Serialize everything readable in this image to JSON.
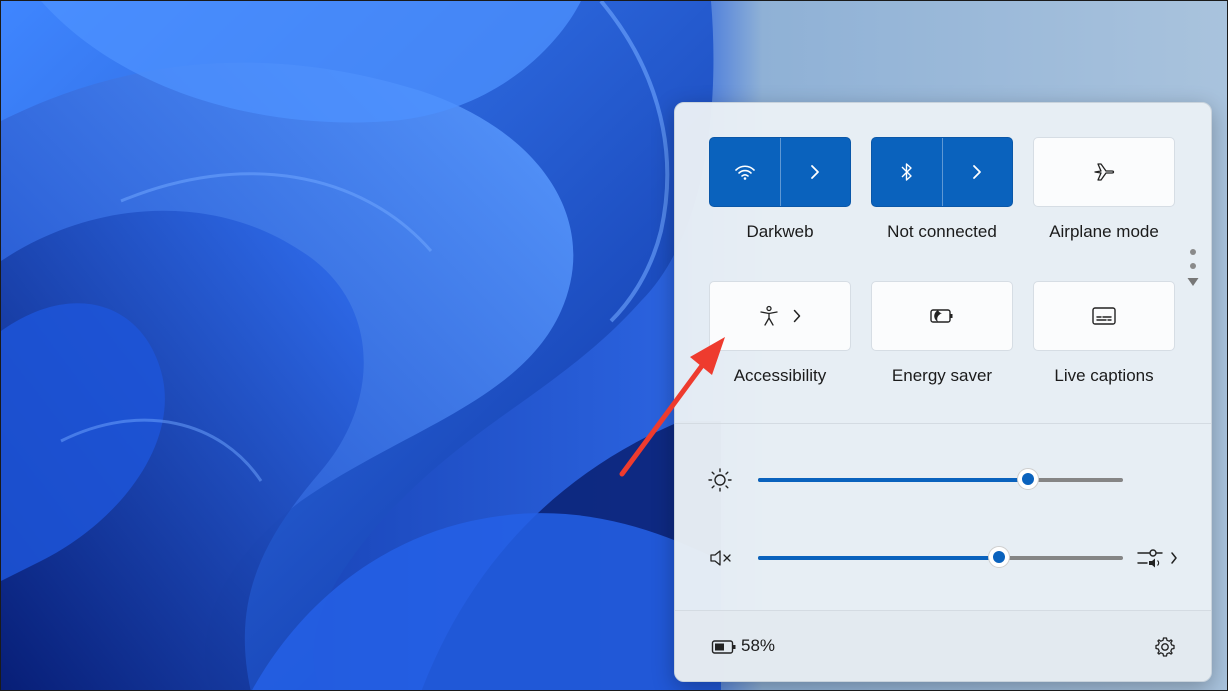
{
  "quick_settings": {
    "tiles": [
      {
        "label": "Darkweb",
        "icon": "wifi-icon",
        "state": "on",
        "expandable": true
      },
      {
        "label": "Not connected",
        "icon": "bluetooth-icon",
        "state": "on",
        "expandable": true
      },
      {
        "label": "Airplane mode",
        "icon": "airplane-icon",
        "state": "off",
        "expandable": false
      },
      {
        "label": "Accessibility",
        "icon": "accessibility-icon",
        "state": "off",
        "expandable": true
      },
      {
        "label": "Energy saver",
        "icon": "energy-saver-icon",
        "state": "off",
        "expandable": false
      },
      {
        "label": "Live captions",
        "icon": "captions-icon",
        "state": "off",
        "expandable": false
      }
    ],
    "page_dots": 2,
    "brightness": {
      "icon": "brightness-icon",
      "value": 0.74
    },
    "volume": {
      "icon": "volume-muted-icon",
      "value": 0.66,
      "end_icon": "audio-output-icon"
    },
    "battery": {
      "icon": "battery-icon",
      "percent_text": "58%"
    },
    "settings_icon": "gear-icon"
  },
  "colors": {
    "accent": "#0a62bd",
    "annotation_arrow": "#ee3b2e"
  }
}
